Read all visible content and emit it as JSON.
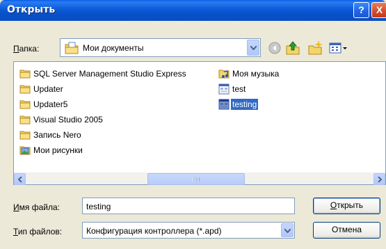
{
  "window": {
    "title": "Открыть"
  },
  "titlebar": {
    "help_label": "?",
    "close_label": "X"
  },
  "lookin": {
    "label": "Папка:",
    "value": "Мои документы"
  },
  "items": [
    {
      "label": "SQL Server Management Studio Express",
      "icon": "folder-icon"
    },
    {
      "label": "Updater",
      "icon": "folder-icon"
    },
    {
      "label": "Updater5",
      "icon": "folder-icon"
    },
    {
      "label": "Visual Studio 2005",
      "icon": "folder-icon"
    },
    {
      "label": "Запись Nero",
      "icon": "folder-icon"
    },
    {
      "label": "Мои рисунки",
      "icon": "pictures-folder-icon"
    },
    {
      "label": "Моя музыка",
      "icon": "music-folder-icon"
    },
    {
      "label": "test",
      "icon": "config-file-icon"
    },
    {
      "label": "testing",
      "icon": "config-file-icon",
      "selected": true
    }
  ],
  "filename": {
    "label_u": "И",
    "label_rest": "мя файла:",
    "value": "testing"
  },
  "filetype": {
    "label_u": "Т",
    "label_rest": "ип файлов:",
    "value": "Конфигурация контроллера (*.apd)"
  },
  "buttons": {
    "open_u": "О",
    "open_rest": "ткрыть",
    "cancel": "Отмена"
  },
  "colors": {
    "titlebar": "#0A5FE6",
    "selection": "#316AC5",
    "dialog_bg": "#ECE9D8"
  }
}
